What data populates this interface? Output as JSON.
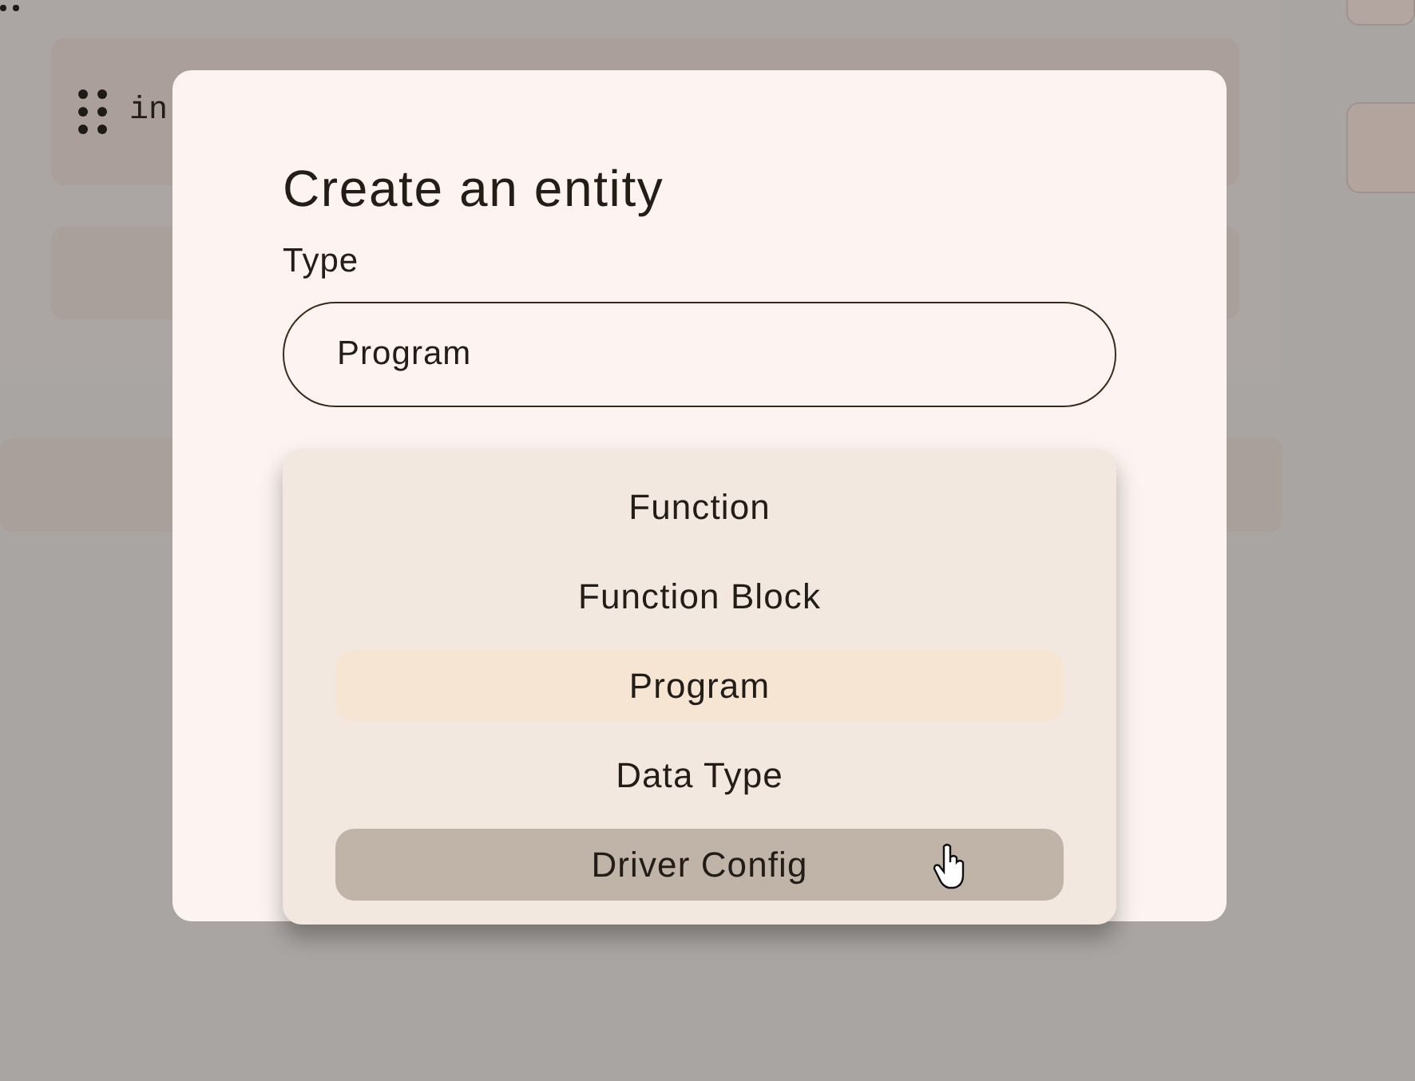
{
  "background": {
    "card_text": "in"
  },
  "dialog": {
    "title": "Create an entity",
    "type_label": "Type",
    "type_value": "Program"
  },
  "dropdown": {
    "options": [
      {
        "label": "Function",
        "selected": false,
        "hovered": false
      },
      {
        "label": "Function Block",
        "selected": false,
        "hovered": false
      },
      {
        "label": "Program",
        "selected": true,
        "hovered": false
      },
      {
        "label": "Data Type",
        "selected": false,
        "hovered": false
      },
      {
        "label": "Driver Config",
        "selected": false,
        "hovered": true
      }
    ]
  }
}
